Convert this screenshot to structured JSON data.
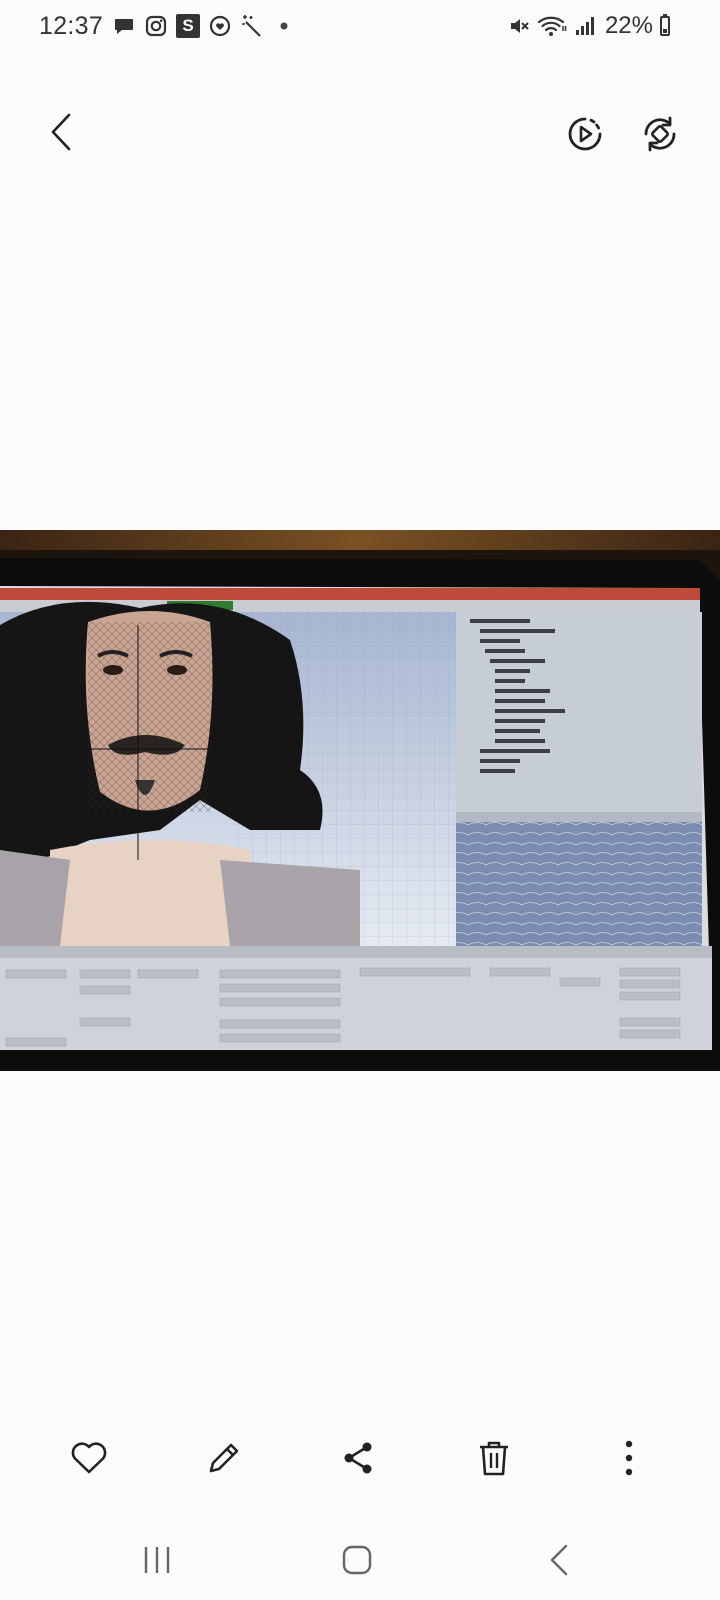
{
  "status_bar": {
    "time": "12:37",
    "battery_percent": "22%",
    "notification_icons": [
      "chat-icon",
      "instagram-icon",
      "s-app-icon",
      "heart-face-icon",
      "magic-wand-icon",
      "dot-icon"
    ],
    "s_app_letter": "S",
    "system_icons": [
      "mute-icon",
      "wifi-icon",
      "signal-icon",
      "battery-icon"
    ]
  },
  "top_bar": {
    "back_icon": "chevron-left-icon",
    "actions": [
      "motion-photo-play-icon",
      "rotate-icon"
    ]
  },
  "photo": {
    "description_icon": "blender-screenshot",
    "viewport_colors": {
      "sky": "#8fa3c7",
      "hair": "#151515",
      "skin": "#caa492"
    }
  },
  "bottom_toolbar": {
    "actions": [
      "favorite-icon",
      "edit-icon",
      "share-icon",
      "delete-icon",
      "more-icon"
    ]
  },
  "nav_bar": {
    "buttons": [
      "recent-apps-icon",
      "home-icon",
      "back-nav-icon"
    ]
  }
}
